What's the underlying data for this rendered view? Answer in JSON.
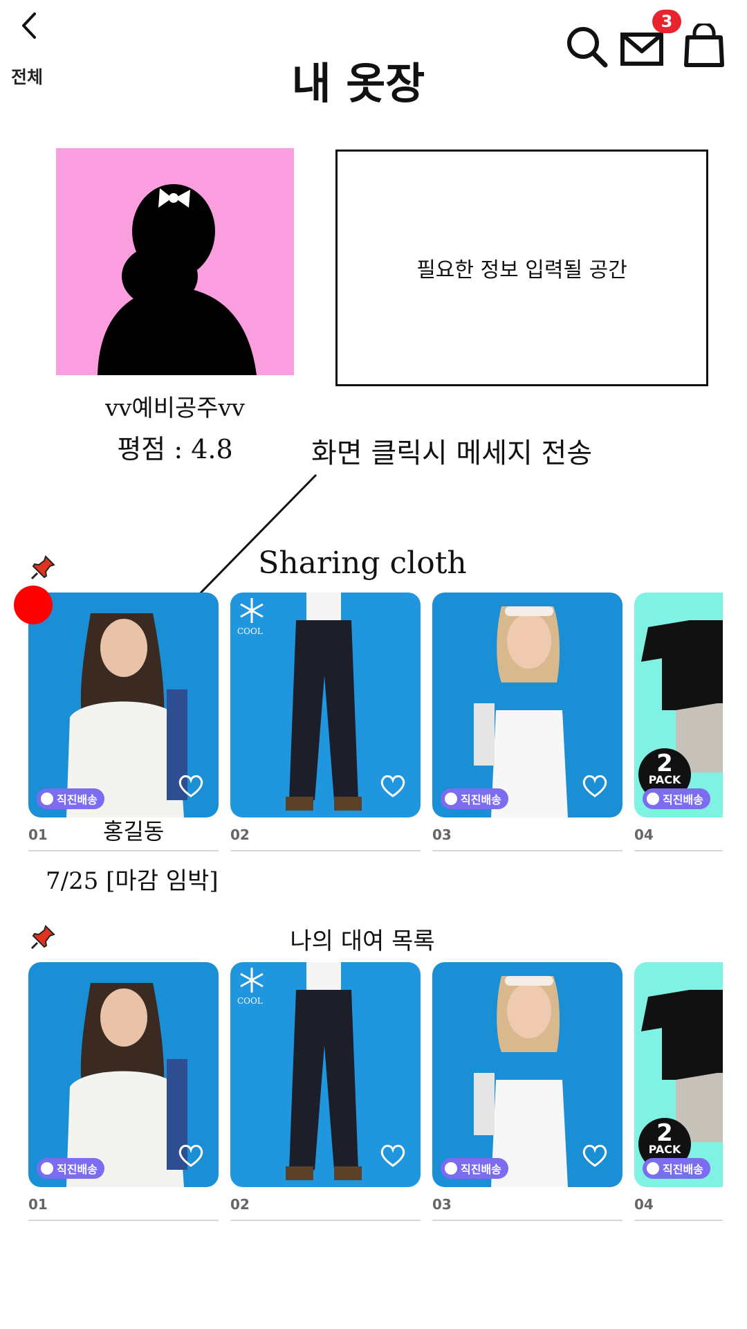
{
  "header": {
    "tab_label": "전체",
    "title": "내 옷장",
    "mail_badge": "3",
    "icons": [
      "back-chevron-icon",
      "search-icon",
      "mail-icon",
      "shopping-bag-icon"
    ]
  },
  "profile": {
    "name": "vv예비공주vv",
    "rating": "평점 : 4.8",
    "info_placeholder": "필요한 정보 입력될 공간",
    "avatar_bg": "#fb9ee0"
  },
  "annotation": {
    "note": "화면 클릭시 메세지 전송"
  },
  "sharing": {
    "title": "Sharing cloth",
    "owner_name": "홍길동",
    "deadline": "7/25 [마감 임박]",
    "cards": [
      {
        "num": "01",
        "badge": "직진배송"
      },
      {
        "num": "02",
        "badge": "",
        "tag": "COOL"
      },
      {
        "num": "03",
        "badge": "직진배송"
      },
      {
        "num": "04",
        "badge": "직진배송",
        "pack_num": "2",
        "pack_word": "PACK"
      }
    ]
  },
  "rental": {
    "title": "나의 대여 목록",
    "cards": [
      {
        "num": "01",
        "badge": "직진배송"
      },
      {
        "num": "02",
        "badge": "",
        "tag": "COOL"
      },
      {
        "num": "03",
        "badge": "직진배송"
      },
      {
        "num": "04",
        "badge": "직진배송",
        "pack_num": "2",
        "pack_word": "PACK"
      }
    ]
  },
  "colors": {
    "accent_badge": "#e8242e",
    "photo_bg": "#1b8fd6",
    "ship_badge": "#7b6cf0",
    "pin": "#e0331f"
  }
}
